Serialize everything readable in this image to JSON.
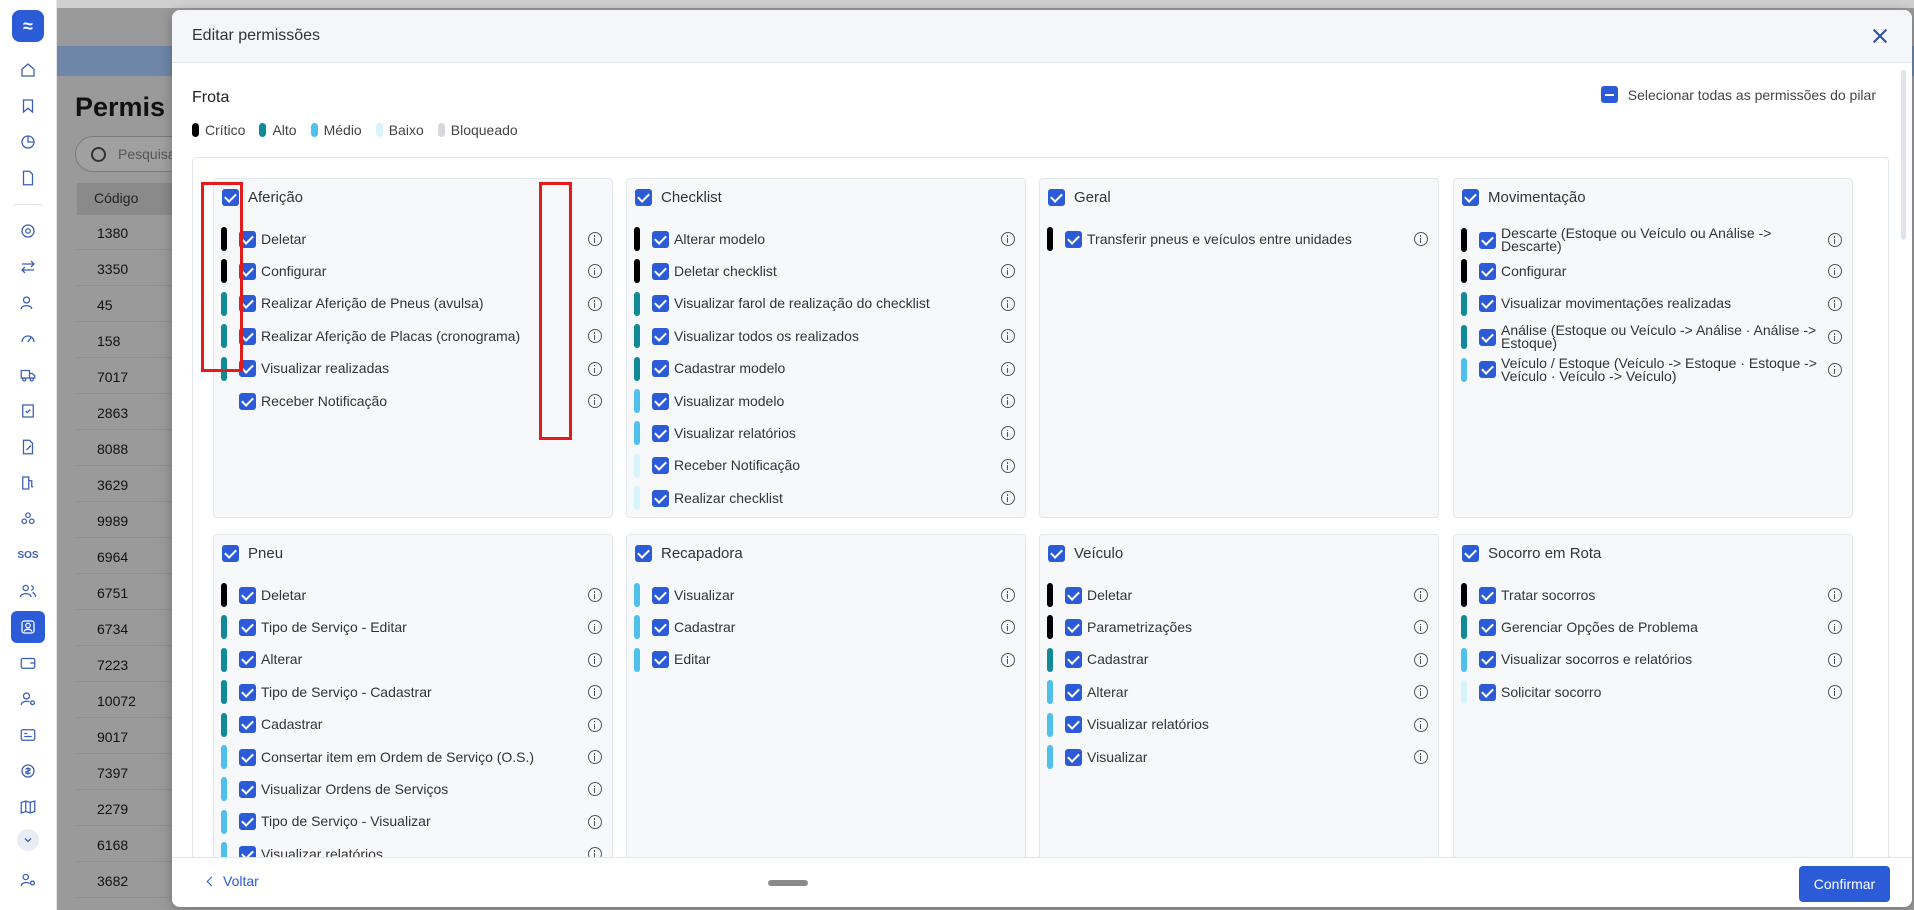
{
  "background": {
    "title": "Permis",
    "search_placeholder": "Pesquisa",
    "column_header": "Código",
    "rows": [
      "1380",
      "3350",
      "45",
      "158",
      "7017",
      "2863",
      "8088",
      "3629",
      "9989",
      "6964",
      "6751",
      "6734",
      "7223",
      "10072",
      "9017",
      "7397",
      "2279",
      "6168",
      "3682"
    ]
  },
  "modal": {
    "title": "Editar permissões",
    "pillar": "Frota",
    "select_all_label": "Selecionar todas as permissões do pilar",
    "legend": [
      {
        "label": "Crítico",
        "color": "#000000"
      },
      {
        "label": "Alto",
        "color": "#0f8a96"
      },
      {
        "label": "Médio",
        "color": "#4fc0ec"
      },
      {
        "label": "Baixo",
        "color": "#d8f4fb"
      },
      {
        "label": "Bloqueado",
        "color": "#d6d8de"
      }
    ],
    "back_label": "Voltar",
    "confirm_label": "Confirmar"
  },
  "cards": [
    {
      "title": "Aferição",
      "items": [
        {
          "label": "Deletar",
          "level": "critico"
        },
        {
          "label": "Configurar",
          "level": "critico"
        },
        {
          "label": "Realizar Aferição de Pneus (avulsa)",
          "level": "alto"
        },
        {
          "label": "Realizar Aferição de Placas (cronograma)",
          "level": "alto"
        },
        {
          "label": "Visualizar realizadas",
          "level": "alto"
        },
        {
          "label": "Receber Notificação",
          "level": "none"
        }
      ]
    },
    {
      "title": "Checklist",
      "items": [
        {
          "label": "Alterar modelo",
          "level": "critico"
        },
        {
          "label": "Deletar checklist",
          "level": "critico"
        },
        {
          "label": "Visualizar farol de realização do checklist",
          "level": "alto"
        },
        {
          "label": "Visualizar todos os realizados",
          "level": "alto"
        },
        {
          "label": "Cadastrar modelo",
          "level": "alto"
        },
        {
          "label": "Visualizar modelo",
          "level": "medio"
        },
        {
          "label": "Visualizar relatórios",
          "level": "medio"
        },
        {
          "label": "Receber Notificação",
          "level": "baixo"
        },
        {
          "label": "Realizar checklist",
          "level": "baixo"
        }
      ]
    },
    {
      "title": "Geral",
      "items": [
        {
          "label": "Transferir pneus e veículos entre unidades",
          "level": "critico"
        }
      ]
    },
    {
      "title": "Movimentação",
      "items": [
        {
          "label": "Descarte (Estoque ou Veículo ou Análise -> Descarte)",
          "level": "critico"
        },
        {
          "label": "Configurar",
          "level": "critico"
        },
        {
          "label": "Visualizar movimentações realizadas",
          "level": "alto"
        },
        {
          "label": "Análise (Estoque ou Veículo -> Análise · Análise -> Estoque)",
          "level": "alto"
        },
        {
          "label": "Veículo / Estoque (Veículo -> Estoque · Estoque -> Veículo · Veículo -> Veículo)",
          "level": "medio"
        }
      ]
    },
    {
      "title": "Pneu",
      "items": [
        {
          "label": "Deletar",
          "level": "critico"
        },
        {
          "label": "Tipo de Serviço - Editar",
          "level": "alto"
        },
        {
          "label": "Alterar",
          "level": "alto"
        },
        {
          "label": "Tipo de Serviço - Cadastrar",
          "level": "alto"
        },
        {
          "label": "Cadastrar",
          "level": "alto"
        },
        {
          "label": "Consertar item em Ordem de Serviço (O.S.)",
          "level": "medio"
        },
        {
          "label": "Visualizar Ordens de Serviços",
          "level": "medio"
        },
        {
          "label": "Tipo de Serviço - Visualizar",
          "level": "medio"
        },
        {
          "label": "Visualizar relatórios",
          "level": "medio"
        }
      ]
    },
    {
      "title": "Recapadora",
      "items": [
        {
          "label": "Visualizar",
          "level": "medio"
        },
        {
          "label": "Cadastrar",
          "level": "medio"
        },
        {
          "label": "Editar",
          "level": "medio"
        }
      ]
    },
    {
      "title": "Veículo",
      "items": [
        {
          "label": "Deletar",
          "level": "critico"
        },
        {
          "label": "Parametrizações",
          "level": "critico"
        },
        {
          "label": "Cadastrar",
          "level": "alto"
        },
        {
          "label": "Alterar",
          "level": "medio"
        },
        {
          "label": "Visualizar relatórios",
          "level": "medio"
        },
        {
          "label": "Visualizar",
          "level": "medio"
        }
      ]
    },
    {
      "title": "Socorro em Rota",
      "items": [
        {
          "label": "Tratar socorros",
          "level": "critico"
        },
        {
          "label": "Gerenciar Opções de Problema",
          "level": "alto"
        },
        {
          "label": "Visualizar socorros e relatórios",
          "level": "medio"
        },
        {
          "label": "Solicitar socorro",
          "level": "baixo"
        }
      ]
    }
  ]
}
